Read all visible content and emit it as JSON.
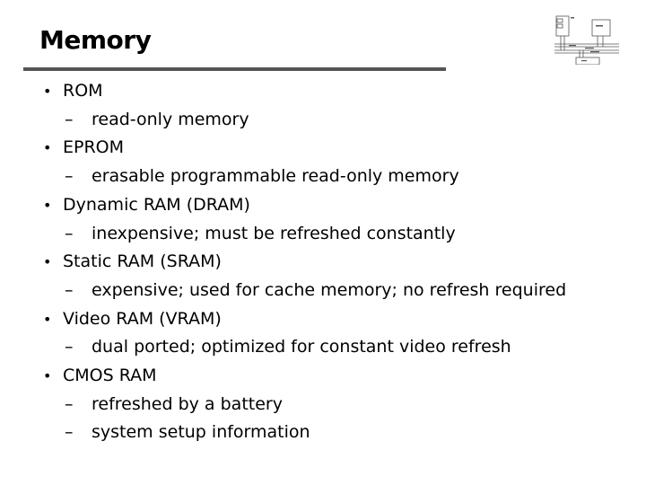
{
  "slide": {
    "title": "Memory",
    "diagram_icon": "computer-bus-diagram"
  },
  "items": [
    {
      "label": "ROM",
      "subs": [
        "read-only memory"
      ]
    },
    {
      "label": "EPROM",
      "subs": [
        "erasable programmable read-only memory"
      ]
    },
    {
      "label": "Dynamic RAM (DRAM)",
      "subs": [
        "inexpensive; must be refreshed constantly"
      ]
    },
    {
      "label": "Static RAM (SRAM)",
      "subs": [
        "expensive; used for cache memory; no refresh required"
      ]
    },
    {
      "label": "Video RAM (VRAM)",
      "subs": [
        "dual ported; optimized for constant video refresh"
      ]
    },
    {
      "label": "CMOS RAM",
      "subs": [
        "refreshed by a battery",
        "system setup information"
      ]
    }
  ],
  "glyphs": {
    "bullet": "•",
    "dash": "–"
  }
}
